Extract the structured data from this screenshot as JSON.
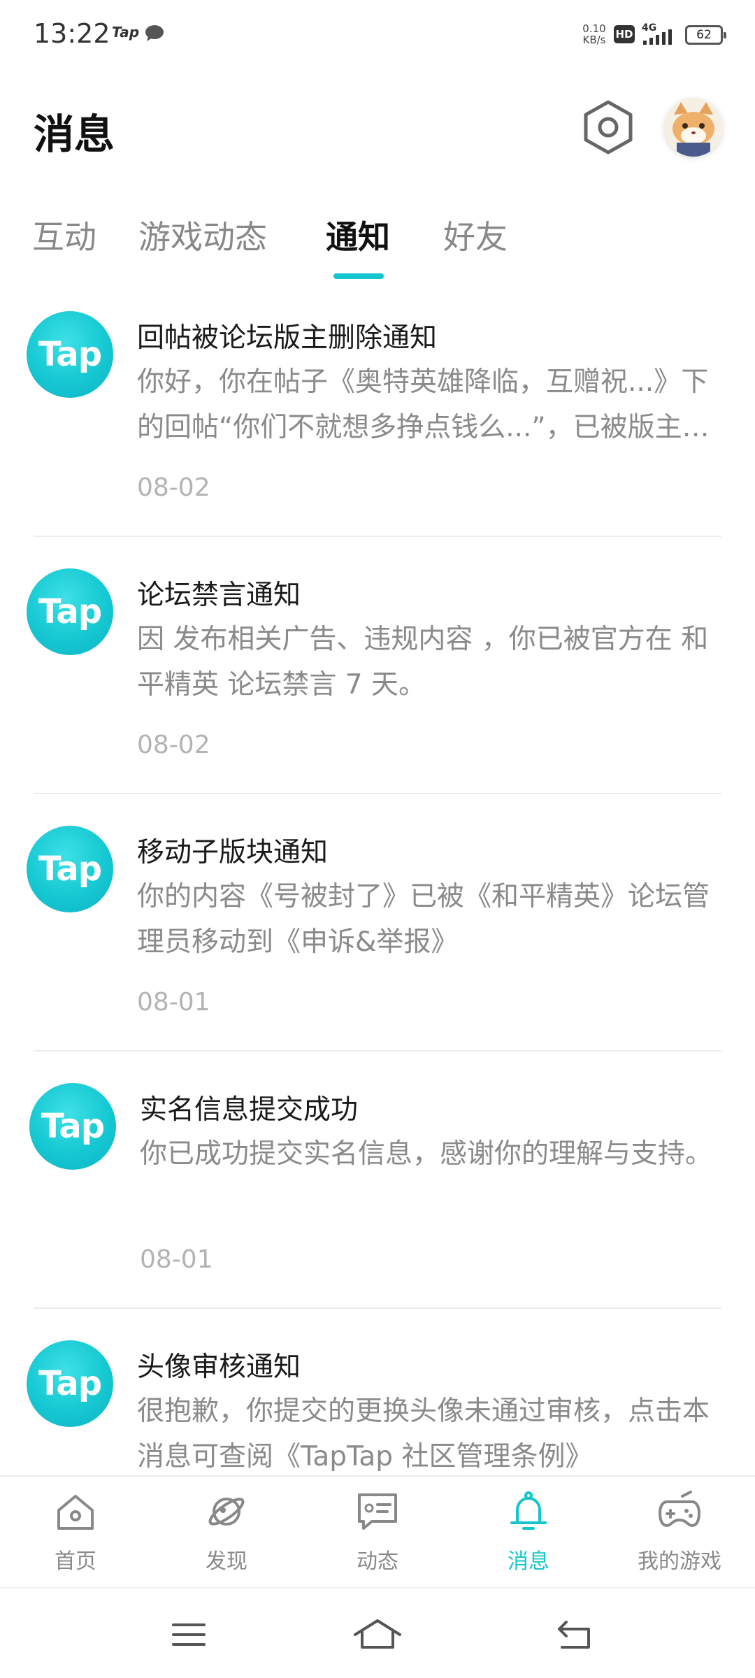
{
  "status_bar": {
    "time": "13:22",
    "app_badge": "Tap",
    "net_speed_value": "0.10",
    "net_speed_unit": "KB/s",
    "hd_badge": "HD",
    "network": "4G",
    "battery": "62"
  },
  "header": {
    "title": "消息",
    "settings_icon": "hexagon-settings-icon",
    "avatar_icon": "cat-avatar"
  },
  "tabs": [
    {
      "label": "互动"
    },
    {
      "label": "游戏动态"
    },
    {
      "label": "通知"
    },
    {
      "label": "好友"
    }
  ],
  "active_tab": "通知",
  "notifications": [
    {
      "logo": "Tap",
      "title": "回帖被论坛版主删除通知",
      "body": "你好，你在帖子《奥特英雄降临，互赠祝...》下的回帖“你们不就想多挣点钱么...”，已被版主删除，原因：违规内容",
      "date": "08-02"
    },
    {
      "logo": "Tap",
      "title": "论坛禁言通知",
      "body": "因 发布相关广告、违规内容 ，你已被官方在 和平精英 论坛禁言 7 天。",
      "date": "08-02"
    },
    {
      "logo": "Tap",
      "title": "移动子版块通知",
      "body": "你的内容《号被封了》已被《和平精英》论坛管理员移动到《申诉&举报》",
      "date": "08-01"
    },
    {
      "logo": "Tap",
      "title": "实名信息提交成功",
      "body": "你已成功提交实名信息，感谢你的理解与支持。",
      "date": "08-01"
    },
    {
      "logo": "Tap",
      "title": "头像审核通知",
      "body": "很抱歉，你提交的更换头像未通过审核，点击本消息可查阅《TapTap 社区管理条例》",
      "date": ""
    }
  ],
  "bottom_nav": [
    {
      "label": "首页",
      "icon": "home-icon"
    },
    {
      "label": "发现",
      "icon": "planet-icon"
    },
    {
      "label": "动态",
      "icon": "chat-card-icon"
    },
    {
      "label": "消息",
      "icon": "bell-icon"
    },
    {
      "label": "我的游戏",
      "icon": "gamepad-icon"
    }
  ],
  "active_nav": "消息",
  "colors": {
    "accent": "#15c5ce",
    "text_primary": "#1a1a1a",
    "text_secondary": "#8a8a8a",
    "date": "#b3b3b3",
    "divider": "#ececec"
  }
}
